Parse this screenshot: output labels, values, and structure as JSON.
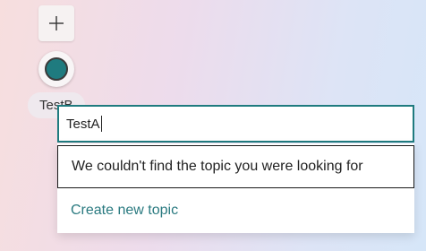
{
  "toolbar": {
    "add_icon": "plus-icon"
  },
  "topic": {
    "avatar_color": "#1f7b7f",
    "pill_label": "TestB"
  },
  "search": {
    "value": "TestA"
  },
  "dropdown": {
    "no_result_message": "We couldn't find the topic you were looking for",
    "create_label": "Create new topic"
  },
  "colors": {
    "accent": "#1f7b7f",
    "link": "#2a7a80"
  }
}
